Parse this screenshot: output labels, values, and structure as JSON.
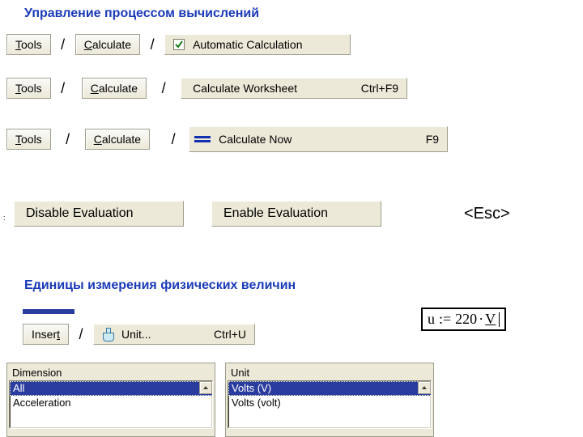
{
  "heading1": "Управление процессом вычислений",
  "heading2": "Единицы измерения физических величин",
  "slash": "/",
  "tinyColon": ":",
  "tools": {
    "pre": "",
    "u": "T",
    "post": "ools"
  },
  "calculate": {
    "pre": "",
    "u": "C",
    "post": "alculate"
  },
  "insert": {
    "pre": "Inser",
    "u": "t",
    "post": ""
  },
  "autoCalc": {
    "pre": "",
    "u": "A",
    "post": "utomatic Calculation"
  },
  "calcWorksheet": {
    "pre": "Calculate ",
    "u": "W",
    "post": "orksheet",
    "shortcut": "Ctrl+F9"
  },
  "calcNow": {
    "pre": "",
    "u": "C",
    "post": "alculate Now",
    "shortcut": "F9"
  },
  "disableEval": {
    "pre": "Disable ",
    "u": "E",
    "post": "valuation"
  },
  "enableEval": {
    "pre": "Enable ",
    "u": "E",
    "post": "valuation"
  },
  "unitMenu": {
    "pre": "",
    "u": "U",
    "post": "nit...",
    "shortcut": "Ctrl+U"
  },
  "escKey": "<Esc>",
  "dimensionLabel": "Dimension",
  "unitLabel": "Unit",
  "dimensionItems": {
    "i0": "All",
    "i1": "Acceleration"
  },
  "unitItems": {
    "i0": "Volts (V)",
    "i1": "Volts (volt)"
  },
  "expr": {
    "lhs": "u",
    "assign": ":=",
    "num": "220",
    "dot": "·",
    "unitU": "V"
  }
}
